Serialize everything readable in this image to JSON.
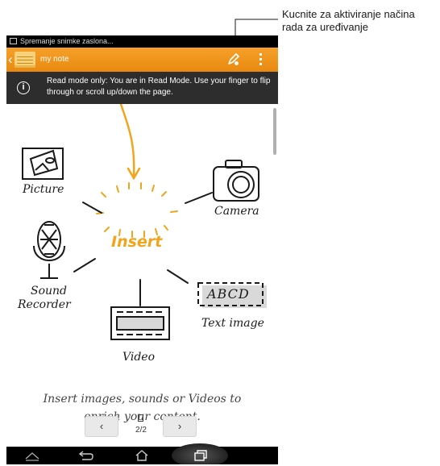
{
  "callout": {
    "line1": "Kucnite za aktiviranje načina",
    "line2": "rada za uređivanje"
  },
  "status_bar": {
    "text": "Spremanje snimke zaslona..."
  },
  "action_bar": {
    "title": "my note",
    "edit_icon": "edit-pen-icon",
    "menu_icon": "overflow-menu-icon",
    "accent_color": "#f0961a"
  },
  "info_bar": {
    "text": "Read mode only: You are in Read Mode. Use your finger to flip through or scroll up/down the page."
  },
  "illustration": {
    "center": "Insert",
    "items": {
      "picture": "Picture",
      "camera": "Camera",
      "sound_line1": "Sound",
      "sound_line2": "Recorder",
      "text_image": "Text image",
      "text_image_box": "ABCD",
      "video": "Video"
    },
    "ink_color": "#f0a51c"
  },
  "tagline": {
    "line1": "Insert images, sounds or Videos to",
    "line2": "enrich your content."
  },
  "pager": {
    "prev": "‹",
    "next": "›",
    "page": "2/2"
  },
  "nav_bar": {
    "icons": [
      "collapse-icon",
      "back-icon",
      "home-icon",
      "recent-apps-icon"
    ]
  }
}
